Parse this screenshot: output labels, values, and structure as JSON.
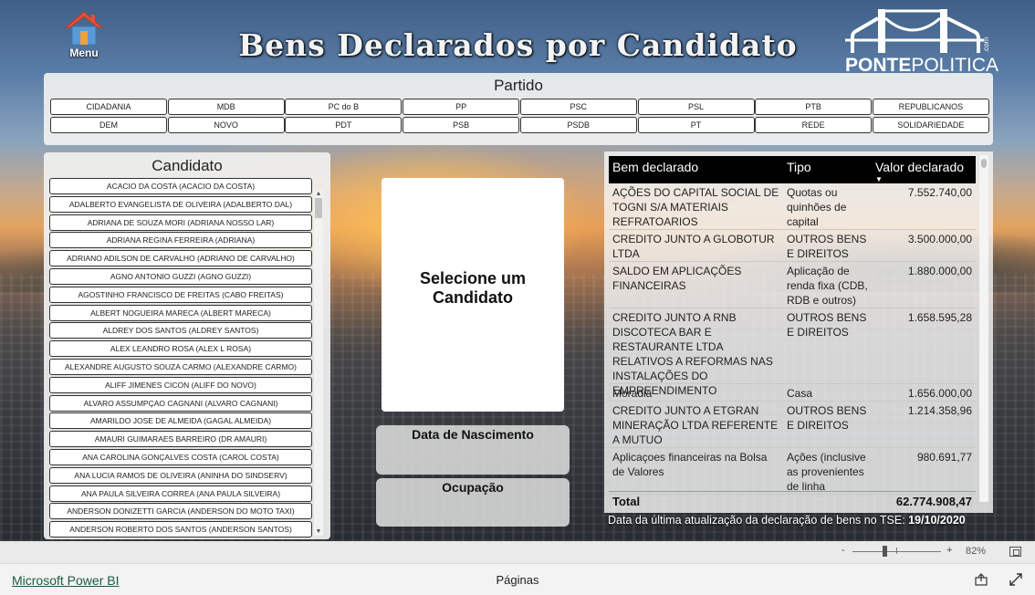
{
  "header": {
    "menu_label": "Menu",
    "title": "Bens Declarados por Candidato",
    "logo_text_bold": "PONTE",
    "logo_text_thin": "POLITICA",
    "logo_suffix": ".com"
  },
  "partido": {
    "title": "Partido",
    "buttons": [
      "CIDADANIA",
      "MDB",
      "PC do B",
      "PP",
      "PSC",
      "PSL",
      "PTB",
      "REPUBLICANOS",
      "DEM",
      "NOVO",
      "PDT",
      "PSB",
      "PSDB",
      "PT",
      "REDE",
      "SOLIDARIEDADE"
    ]
  },
  "candidato": {
    "title": "Candidato",
    "items": [
      "ACACIO DA COSTA (ACACIO DA COSTA)",
      "ADALBERTO EVANGELISTA DE OLIVEIRA (ADALBERTO DAL)",
      "ADRIANA DE SOUZA MORI (ADRIANA NOSSO LAR)",
      "ADRIANA REGINA FERREIRA (ADRIANA)",
      "ADRIANO ADILSON DE CARVALHO (ADRIANO DE CARVALHO)",
      "AGNO ANTONIO GUZZI (AGNO GUZZI)",
      "AGOSTINHO FRANCISCO DE FREITAS (CABO FREITAS)",
      "ALBERT NOGUEIRA MARECA (ALBERT MARECA)",
      "ALDREY DOS SANTOS (ALDREY SANTOS)",
      "ALEX LEANDRO ROSA (ALEX L ROSA)",
      "ALEXANDRE AUGUSTO SOUZA CARMO (ALEXANDRE CARMO)",
      "ALIFF JIMENES CICON (ALIFF DO NOVO)",
      "ALVARO ASSUMPÇAO CAGNANI (ALVARO CAGNANI)",
      "AMARILDO JOSE DE ALMEIDA (GAGAL ALMEIDA)",
      "AMAURI GUIMARAES BARREIRO (DR AMAURI)",
      "ANA CAROLINA GONÇALVES COSTA (CAROL COSTA)",
      "ANA LUCIA RAMOS DE OLIVEIRA (ANINHA DO SINDSERV)",
      "ANA PAULA SILVEIRA CORREA (ANA PAULA SILVEIRA)",
      "ANDERSON DONIZETTI GARCIA (ANDERSON DO MOTO TAXI)",
      "ANDERSON ROBERTO DOS SANTOS (ANDERSON SANTOS)"
    ]
  },
  "photo_card": {
    "line1": "Selecione um",
    "line2": "Candidato"
  },
  "cards": {
    "nascimento": "Data de Nascimento",
    "ocupacao": "Ocupação"
  },
  "bens": {
    "columns": [
      "Bem declarado",
      "Tipo",
      "Valor declarado"
    ],
    "rows": [
      {
        "bem": "AÇÕES DO CAPITAL SOCIAL DE TOGNI S/A MATERIAIS REFRATOARIOS",
        "tipo": "Quotas ou quinhões de capital",
        "valor": "7.552.740,00"
      },
      {
        "bem": "CREDITO JUNTO A GLOBOTUR LTDA",
        "tipo": "OUTROS BENS E DIREITOS",
        "valor": "3.500.000,00"
      },
      {
        "bem": "SALDO EM APLICAÇÕES FINANCEIRAS",
        "tipo": "Aplicação de renda fixa (CDB, RDB e outros)",
        "valor": "1.880.000,00"
      },
      {
        "bem": "CREDITO JUNTO A RNB DISCOTECA BAR E RESTAURANTE LTDA RELATIVOS A REFORMAS NAS INSTALAÇÕES DO EMPREENDIMENTO",
        "tipo": "OUTROS BENS E DIREITOS",
        "valor": "1.658.595,28"
      },
      {
        "bem": "Moradia",
        "tipo": "Casa",
        "valor": "1.656.000,00"
      },
      {
        "bem": "CREDITO JUNTO A ETGRAN MINERAÇÃO LTDA REFERENTE A MUTUO",
        "tipo": "OUTROS BENS E DIREITOS",
        "valor": "1.214.358,96"
      },
      {
        "bem": "Aplicaçoes financeiras na Bolsa de Valores",
        "tipo": "Ações (inclusive as provenientes de linha",
        "valor": "980.691,77"
      }
    ],
    "total_label": "Total",
    "total_value": "62.774.908,47"
  },
  "update_note": {
    "text": "Data da última atualização da declaração de bens no TSE:",
    "date": "19/10/2020"
  },
  "zoom": {
    "minus": "-",
    "plus": "+",
    "percent": "82%"
  },
  "footer": {
    "brand": "Microsoft Power BI",
    "pages": "Páginas"
  },
  "colors": {
    "table_header": "#000000",
    "panel_bg": "#f0f0f0",
    "house_roof": "#e3513a",
    "house_body": "#5a9ad6",
    "brand_link": "#1a5c3e"
  },
  "icons": [
    "house-icon",
    "sort-desc-icon",
    "fit-page-icon",
    "share-icon",
    "expand-icon"
  ]
}
